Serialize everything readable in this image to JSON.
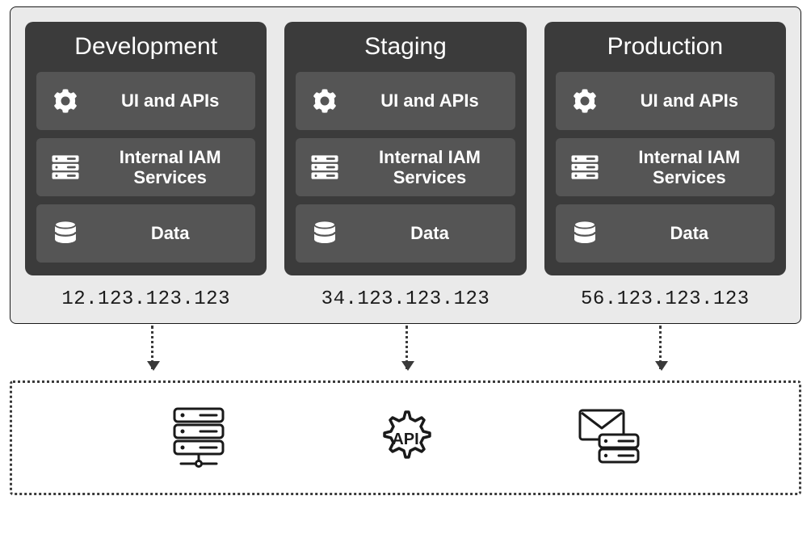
{
  "environments": [
    {
      "title": "Development",
      "rows": [
        {
          "icon": "gear-icon",
          "label": "UI and APIs"
        },
        {
          "icon": "server-icon",
          "label": "Internal IAM Services"
        },
        {
          "icon": "database-icon",
          "label": "Data"
        }
      ],
      "ip": "12.123.123.123"
    },
    {
      "title": "Staging",
      "rows": [
        {
          "icon": "gear-icon",
          "label": "UI and APIs"
        },
        {
          "icon": "server-icon",
          "label": "Internal IAM Services"
        },
        {
          "icon": "database-icon",
          "label": "Data"
        }
      ],
      "ip": "34.123.123.123"
    },
    {
      "title": "Production",
      "rows": [
        {
          "icon": "gear-icon",
          "label": "UI and APIs"
        },
        {
          "icon": "server-icon",
          "label": "Internal IAM Services"
        },
        {
          "icon": "database-icon",
          "label": "Data"
        }
      ],
      "ip": "56.123.123.123"
    }
  ],
  "bottom_services": [
    {
      "icon": "server-rack-icon"
    },
    {
      "icon": "api-gear-icon"
    },
    {
      "icon": "mail-server-icon"
    }
  ]
}
